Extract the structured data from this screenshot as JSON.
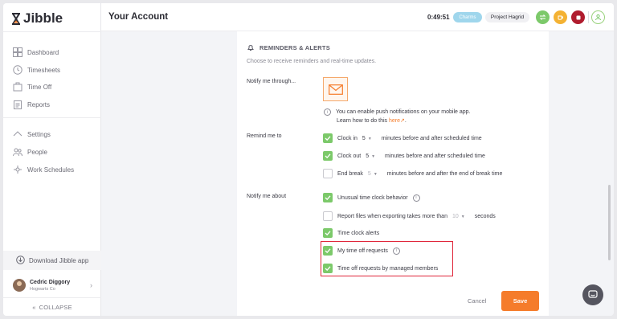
{
  "app": {
    "logo_text": "Jibble"
  },
  "sidebar": {
    "items": [
      {
        "label": "Dashboard",
        "icon": "dashboard-icon"
      },
      {
        "label": "Timesheets",
        "icon": "clock-icon"
      },
      {
        "label": "Time Off",
        "icon": "suitcase-icon"
      },
      {
        "label": "Reports",
        "icon": "clipboard-icon"
      },
      {
        "label": "Settings",
        "icon": "chevron-up-icon"
      },
      {
        "label": "People",
        "icon": "people-icon"
      },
      {
        "label": "Work Schedules",
        "icon": "schedule-icon"
      }
    ],
    "download_label": "Download Jibble app",
    "user": {
      "name": "Cedric Diggory",
      "org": "Hogwarts Co"
    },
    "collapse_label": "COLLAPSE"
  },
  "header": {
    "title": "Your Account",
    "timer": "0:49:51",
    "activity": "Charms",
    "project": "Project Hagrid",
    "colors": {
      "green": "#7cc96a",
      "yellow": "#f4b233",
      "red": "#b01c2e"
    }
  },
  "reminders": {
    "section_title": "REMINDERS & ALERTS",
    "section_subtitle": "Choose to receive reminders and real-time updates.",
    "notify_through_label": "Notify me through...",
    "push_info_line1": "You can enable push notifications on your mobile app.",
    "push_info_line2_prefix": "Learn how to do this",
    "push_info_link": "here",
    "push_info_suffix": ".",
    "remind_label": "Remind me to",
    "clock_in": {
      "label": "Clock in",
      "value": "5",
      "suffix": "minutes before and after scheduled time",
      "checked": true
    },
    "clock_out": {
      "label": "Clock out",
      "value": "5",
      "suffix": "minutes before and after scheduled time",
      "checked": true
    },
    "end_break": {
      "label": "End break",
      "value": "5",
      "suffix": "minutes before and after the end of break time",
      "checked": false
    },
    "notify_about_label": "Notify me about",
    "unusual": {
      "label": "Unusual time clock behavior",
      "checked": true
    },
    "report_files": {
      "label": "Report files when exporting takes more than",
      "value": "10",
      "suffix": "seconds",
      "checked": false
    },
    "time_clock_alerts": {
      "label": "Time clock alerts",
      "checked": true
    },
    "my_time_off": {
      "label": "My time off requests",
      "checked": true
    },
    "managed_time_off": {
      "label": "Time off requests by managed members",
      "checked": true
    }
  },
  "actions": {
    "cancel_label": "Cancel",
    "save_label": "Save",
    "accent": "#f57c2b"
  }
}
